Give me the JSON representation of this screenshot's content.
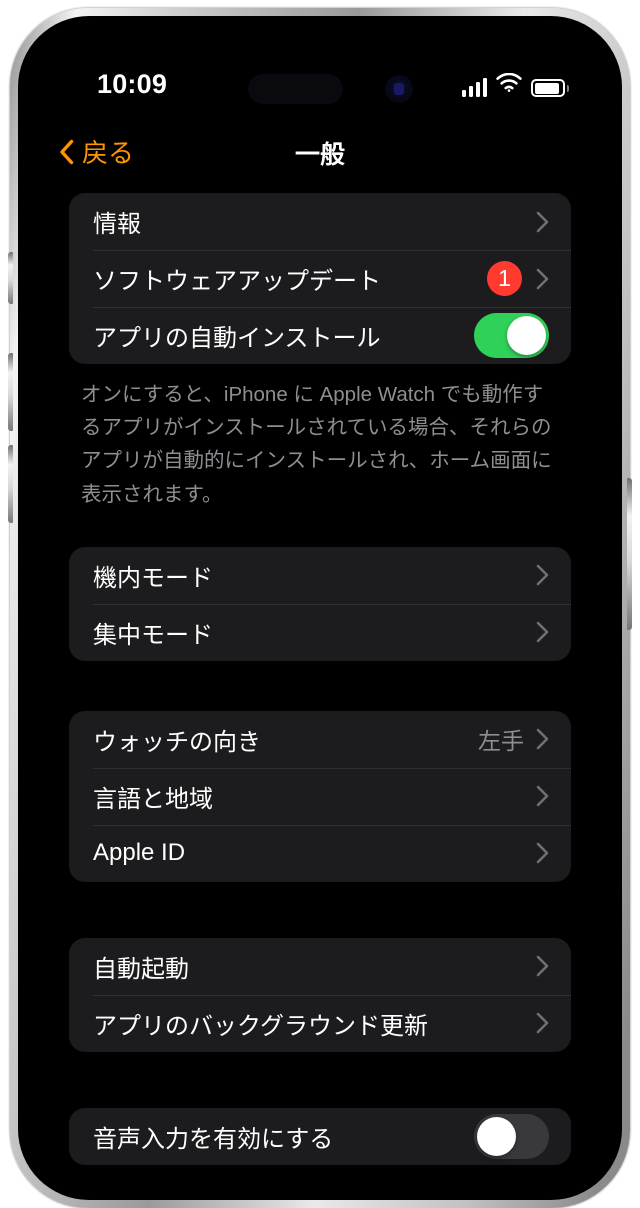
{
  "status_bar": {
    "time": "10:09",
    "cellular_icon": "signal-bars-icon",
    "wifi_icon": "wifi-icon",
    "battery_icon": "battery-icon"
  },
  "nav": {
    "back_label": "戻る",
    "back_icon": "chevron-left-icon",
    "title": "一般"
  },
  "colors": {
    "accent": "#FF9500",
    "toggle_on": "#30D158",
    "toggle_off": "#39393D",
    "badge": "#FF3B30",
    "row_background": "#1C1C1E",
    "screen_background": "#000000",
    "secondary_text": "#8E8E93"
  },
  "groups": [
    {
      "rows": [
        {
          "label": "情報",
          "accessory": "chevron"
        },
        {
          "label": "ソフトウェアアップデート",
          "accessory": "chevron",
          "badge": "1"
        },
        {
          "label": "アプリの自動インストール",
          "accessory": "toggle",
          "toggle_state": "on"
        }
      ],
      "footnote": "オンにすると、iPhone に Apple Watch でも動作するアプリがインストールされている場合、それらのアプリが自動的にインストールされ、ホーム画面に表示されます。"
    },
    {
      "rows": [
        {
          "label": "機内モード",
          "accessory": "chevron"
        },
        {
          "label": "集中モード",
          "accessory": "chevron"
        }
      ]
    },
    {
      "rows": [
        {
          "label": "ウォッチの向き",
          "accessory": "chevron",
          "value": "左手"
        },
        {
          "label": "言語と地域",
          "accessory": "chevron"
        },
        {
          "label": "Apple ID",
          "accessory": "chevron"
        }
      ]
    },
    {
      "rows": [
        {
          "label": "自動起動",
          "accessory": "chevron"
        },
        {
          "label": "アプリのバックグラウンド更新",
          "accessory": "chevron"
        }
      ]
    },
    {
      "rows": [
        {
          "label": "音声入力を有効にする",
          "accessory": "toggle",
          "toggle_state": "off"
        }
      ]
    }
  ]
}
